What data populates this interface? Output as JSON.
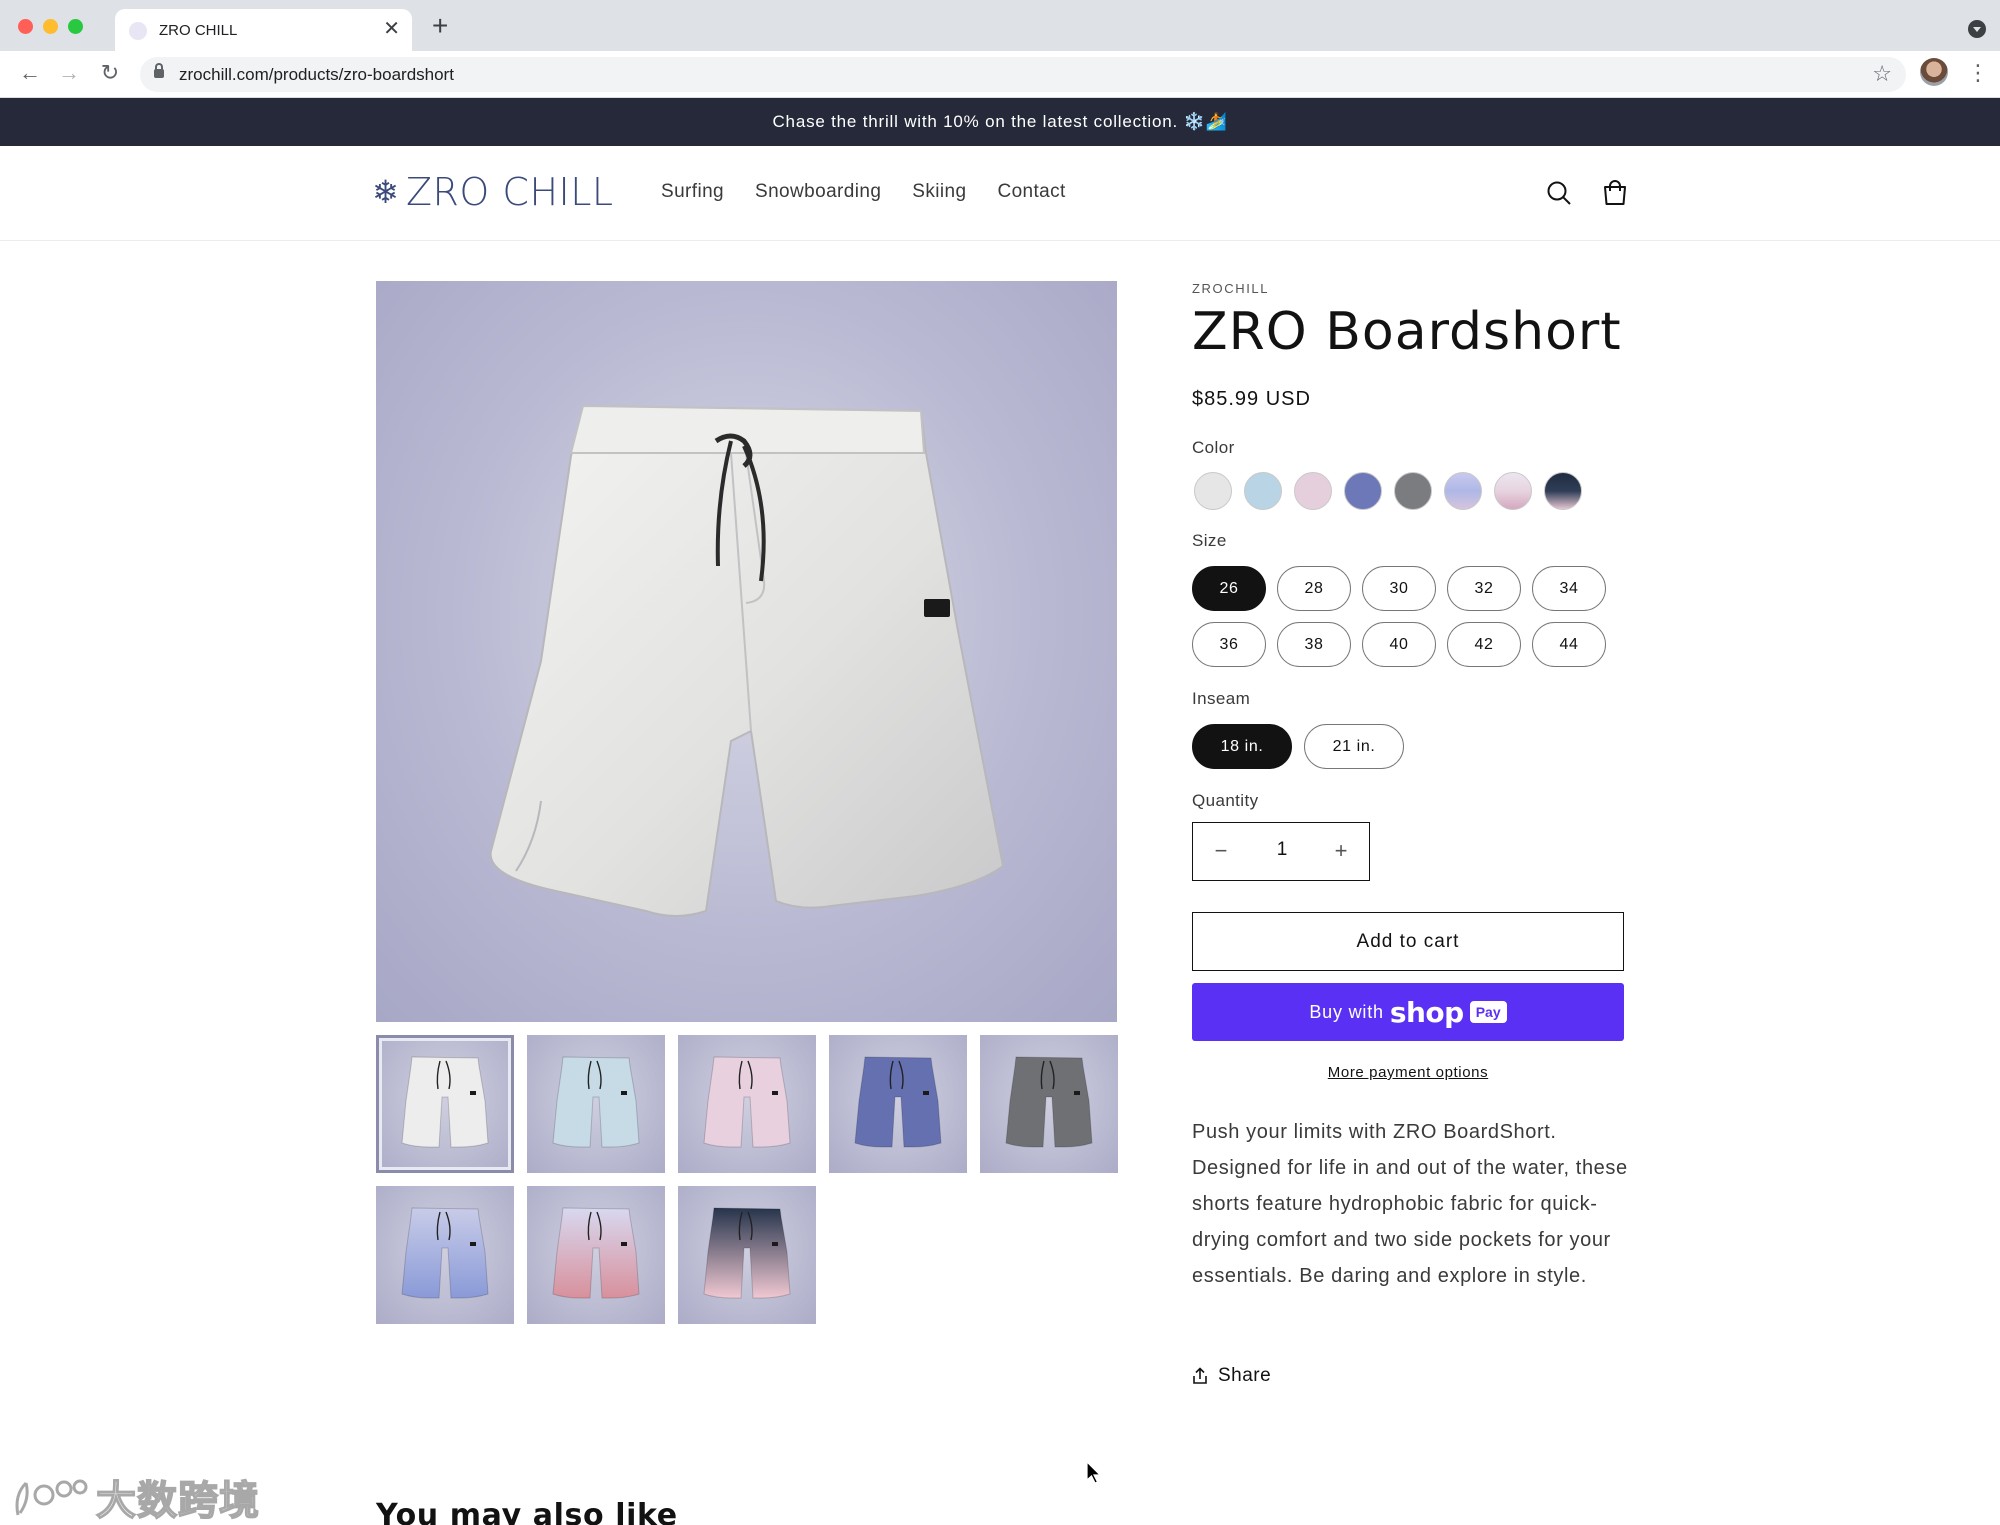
{
  "browser": {
    "tab_title": "ZRO CHILL",
    "tab_close": "✕",
    "new_tab": "+",
    "url": "zrochill.com/products/zro-boardshort",
    "icons": [
      "back-arrow-icon",
      "forward-arrow-icon",
      "reload-icon",
      "lock-icon",
      "star-icon",
      "profile-avatar",
      "more-vert-icon"
    ]
  },
  "announcement": "Chase the thrill with 10% on the latest collection. ❄️🏄",
  "header": {
    "logo": "ZRO CHILL",
    "menu": [
      "Surfing",
      "Snowboarding",
      "Skiing",
      "Contact"
    ],
    "icons": [
      "search-icon",
      "cart-icon"
    ]
  },
  "product": {
    "vendor": "ZROCHILL",
    "title": "ZRO Boardshort",
    "price": "$85.99 USD",
    "color_label": "Color",
    "colors": [
      "#e6e6e6",
      "#b9d4e4",
      "#e6cfdc",
      "#6c78b8",
      "#7a7c80",
      "#aeb8e6",
      "#e7d3e0",
      "#2f3d57"
    ],
    "size_label": "Size",
    "sizes": [
      "26",
      "28",
      "30",
      "32",
      "34",
      "36",
      "38",
      "40",
      "42",
      "44"
    ],
    "selected_size": "26",
    "inseam_label": "Inseam",
    "inseams": [
      "18 in.",
      "21 in."
    ],
    "selected_inseam": "18 in.",
    "quantity_label": "Quantity",
    "quantity": "1",
    "qty_minus": "−",
    "qty_plus": "+",
    "add_to_cart": "Add to cart",
    "buy_with": "Buy with",
    "shop": "shop",
    "pay": "Pay",
    "more_payment": "More payment options",
    "description": "Push your limits with ZRO BoardShort. Designed for life in and out of the water, these shorts feature hydrophobic fabric for quick-drying comfort and two side pockets for your essentials. Be daring and explore in style.",
    "share": "Share",
    "thumb_colors": [
      "#ededed",
      "#c6dbe6",
      "#e8d0de",
      "#6470b0",
      "#6e7074",
      "#a8b6e8",
      "#e2c4d4",
      "#3d4d66"
    ]
  },
  "recommendations_title": "You may also like",
  "watermark": "大数跨境"
}
